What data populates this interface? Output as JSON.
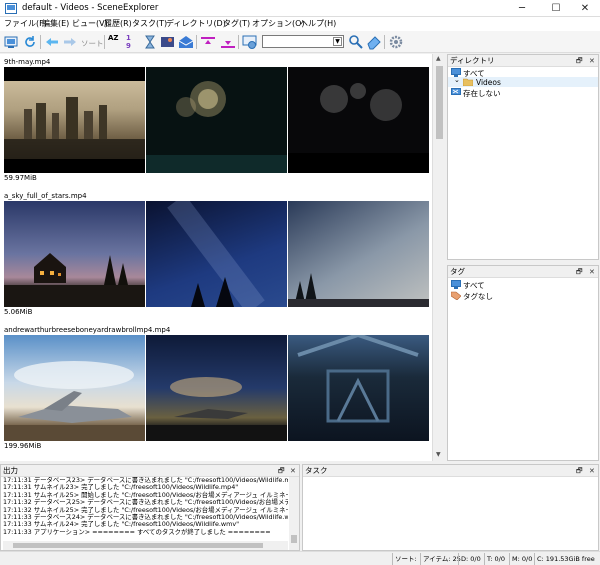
{
  "window": {
    "title": "default - Videos - SceneExplorer",
    "minimize_glyph": "─",
    "maximize_glyph": "☐",
    "close_glyph": "✕"
  },
  "menu": [
    "ファイル(F)",
    "編集(E)",
    "ビュー(V)",
    "履歴(R)",
    "タスク(T)",
    "ディレクトリ(D)",
    "タグ(T)",
    "オプション(O)",
    "ヘルプ(H)"
  ],
  "toolbar": {
    "sort_label": "ソート",
    "sort_az_text": "AZ",
    "sort_num_text": "19",
    "filter_value": ""
  },
  "videos": [
    {
      "name": "9th-may.mp4",
      "size": "59.97MiB"
    },
    {
      "name": "a_sky_full_of_stars.mp4",
      "size": "5.06MiB"
    },
    {
      "name": "andrewarthurbreeseboneyardrawbrollmp4.mp4",
      "size": "199.96MiB"
    }
  ],
  "directory_panel": {
    "title": "ディレクトリ",
    "items": [
      "すべて",
      "Videos",
      "存在しない"
    ],
    "collapse_glyph": "⌄"
  },
  "tag_panel": {
    "title": "タグ",
    "items": [
      "すべて",
      "タグなし"
    ]
  },
  "panel_pin_glyph": "🗗",
  "panel_close_glyph": "✕",
  "output_panel": {
    "title": "出力",
    "lines": [
      "17:11:31 データベース23> データベースに書き込まれました \"C:/freesoft100/Videos/Wildlife.mp4\"",
      "17:11:31 サムネイル23> 完了しました \"C:/freesoft100/Videos/Wildlife.mp4\"",
      "17:11:31 サムネイル25> 開始しました \"C:/freesoft100/Videos/お台場メディアージュ イルミネーション",
      "17:11:32 データベース25> データベースに書き込まれました \"C:/freesoft100/Videos/お台場メディアー",
      "17:11:32 サムネイル25> 完了しました \"C:/freesoft100/Videos/お台場メディアージュ イルミネーション",
      "17:11:33 データベース24> データベースに書き込まれました \"C:/freesoft100/Videos/Wildlife.wmv\"",
      "17:11:33 サムネイル24> 完了しました \"C:/freesoft100/Videos/Wildlife.wmv\"",
      "17:11:33 アプリケーション> ======== すべてのタスクが終了しました ========"
    ]
  },
  "task_panel": {
    "title": "タスク"
  },
  "status": {
    "sort": "ソート: ",
    "items": "アイテム: 25",
    "d": "D: 0/0",
    "t": "T: 0/0",
    "m": "M: 0/0",
    "free": "C: 191.53GiB free"
  }
}
